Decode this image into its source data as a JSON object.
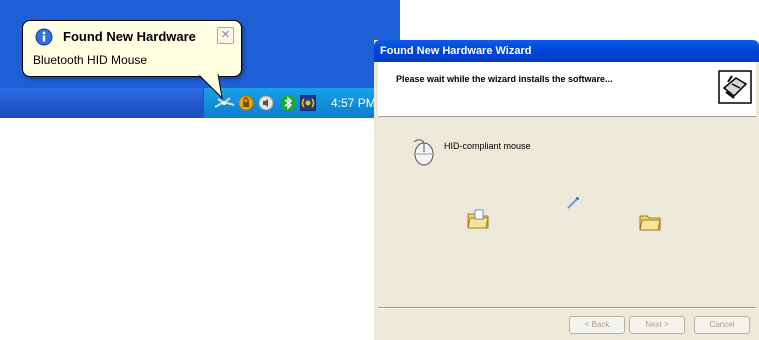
{
  "taskbar": {
    "clock": "4:57 PM",
    "tray_icons": [
      "network-icon",
      "security-shield-icon",
      "volume-icon",
      "bluetooth-icon",
      "wireless-icon"
    ]
  },
  "balloon": {
    "title": "Found New Hardware",
    "message": "Bluetooth HID Mouse",
    "close_glyph": "✕",
    "icon": "info-icon"
  },
  "wizard": {
    "title": "Found New Hardware Wizard",
    "header_text": "Please wait while the wizard installs the software...",
    "header_icon": "hardware-wizard-icon",
    "device_name": "HID-compliant mouse",
    "device_icon": "mouse-icon",
    "buttons": {
      "back": "< Back",
      "next": "Next >",
      "cancel": "Cancel"
    }
  },
  "colors": {
    "desktop": "#1f5fd6",
    "taskbar": "#2458d0",
    "tray": "#0f8cd8",
    "balloon_bg": "#ffffe1",
    "wizard_titlebar": "#0048d8",
    "dialog_face": "#ece9d8"
  }
}
